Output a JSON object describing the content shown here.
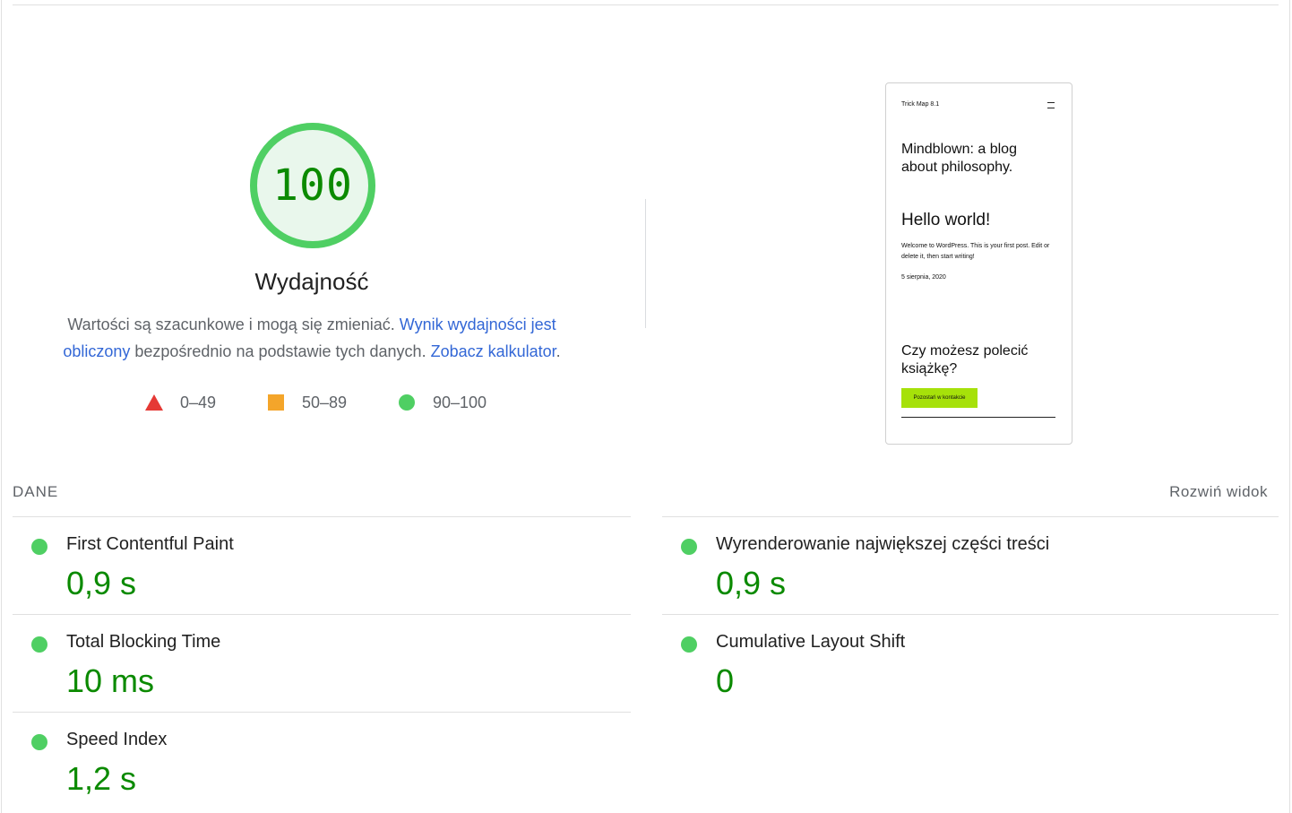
{
  "gauge": {
    "score": "100",
    "score_fraction": 1.0,
    "title": "Wydajność",
    "color_pass": "#0cce6b",
    "color_score_text": "#0b8a00",
    "color_fill": "#e6f6ea"
  },
  "description": {
    "text1": "Wartości są szacunkowe i mogą się zmieniać. ",
    "link1": "Wynik wydajności jest obliczony",
    "text2": " bezpośrednio na podstawie tych danych. ",
    "link2": "Zobacz kalkulator",
    "text3": "."
  },
  "legend": {
    "fail": {
      "label": "0–49",
      "icon": "red-triangle-icon",
      "color": "#e53935"
    },
    "average": {
      "label": "50–89",
      "icon": "orange-square-icon",
      "color": "#f4a52a"
    },
    "pass": {
      "label": "90–100",
      "icon": "green-circle-icon",
      "color": "#4fcf63"
    }
  },
  "screenshot": {
    "site_title": "Trick Map 8.1",
    "menu_icon": "hamburger-menu-icon",
    "tagline": "Mindblown: a blog about philosophy.",
    "post_title": "Hello world!",
    "post_excerpt": "Welcome to WordPress. This is your first post. Edit or delete it, then start writing!",
    "post_date": "5 sierpnia, 2020",
    "cta_heading": "Czy możesz polecić książkę?",
    "cta_button": "Pozostań w kontakcie",
    "cta_button_color": "#a6e10a"
  },
  "metrics": {
    "section_label": "DANE",
    "expand_label": "Rozwiń widok",
    "items": [
      {
        "title": "First Contentful Paint",
        "value": "0,9 s"
      },
      {
        "title": "Wyrenderowanie największej części treści",
        "value": "0,9 s"
      },
      {
        "title": "Total Blocking Time",
        "value": "10 ms"
      },
      {
        "title": "Cumulative Layout Shift",
        "value": "0"
      },
      {
        "title": "Speed Index",
        "value": "1,2 s"
      }
    ]
  }
}
